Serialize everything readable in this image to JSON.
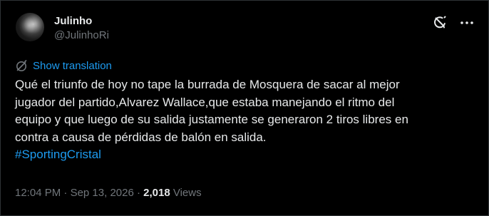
{
  "author": {
    "display_name": "Julinho",
    "handle": "@JulinhoRi"
  },
  "icons": {
    "grok": "grok-icon",
    "more": "more-options-icon",
    "translate": "globe-translate-icon"
  },
  "translation": {
    "label": "Show translation"
  },
  "tweet": {
    "body": "Qué el triunfo de hoy no tape la burrada de Mosquera de sacar al mejor\njugador del partido,Alvarez Wallace,que estaba manejando el ritmo del\nequipo y que luego de su salida justamente se generaron 2 tiros libres en\ncontra a causa de pérdidas de balón en salida.",
    "hashtag": "#SportingCristal"
  },
  "meta": {
    "time": "12:04 PM",
    "separator1": " · ",
    "date": "Sep 13, 2026",
    "separator2": " · ",
    "views_count": "2,018",
    "views_label": " Views"
  },
  "colors": {
    "background": "#000000",
    "primary_text": "#e7e9ea",
    "secondary_text": "#71767b",
    "accent": "#1d9bf0",
    "border": "#2f3336"
  }
}
